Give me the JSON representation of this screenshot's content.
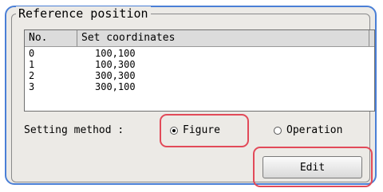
{
  "group": {
    "title": "Reference position"
  },
  "list": {
    "columns": [
      "No.",
      "Set coordinates"
    ],
    "rows": [
      {
        "no": "0",
        "coord": "100,100"
      },
      {
        "no": "1",
        "coord": "100,300"
      },
      {
        "no": "2",
        "coord": "300,300"
      },
      {
        "no": "3",
        "coord": "300,100"
      }
    ]
  },
  "setting": {
    "label": "Setting method :",
    "options": [
      {
        "label": "Figure",
        "checked": true
      },
      {
        "label": "Operation",
        "checked": false
      }
    ]
  },
  "edit_button": {
    "label": "Edit"
  },
  "colors": {
    "panel_border": "#4a7fd6",
    "highlight": "#e24a59",
    "panel_bg": "#eceae6"
  }
}
